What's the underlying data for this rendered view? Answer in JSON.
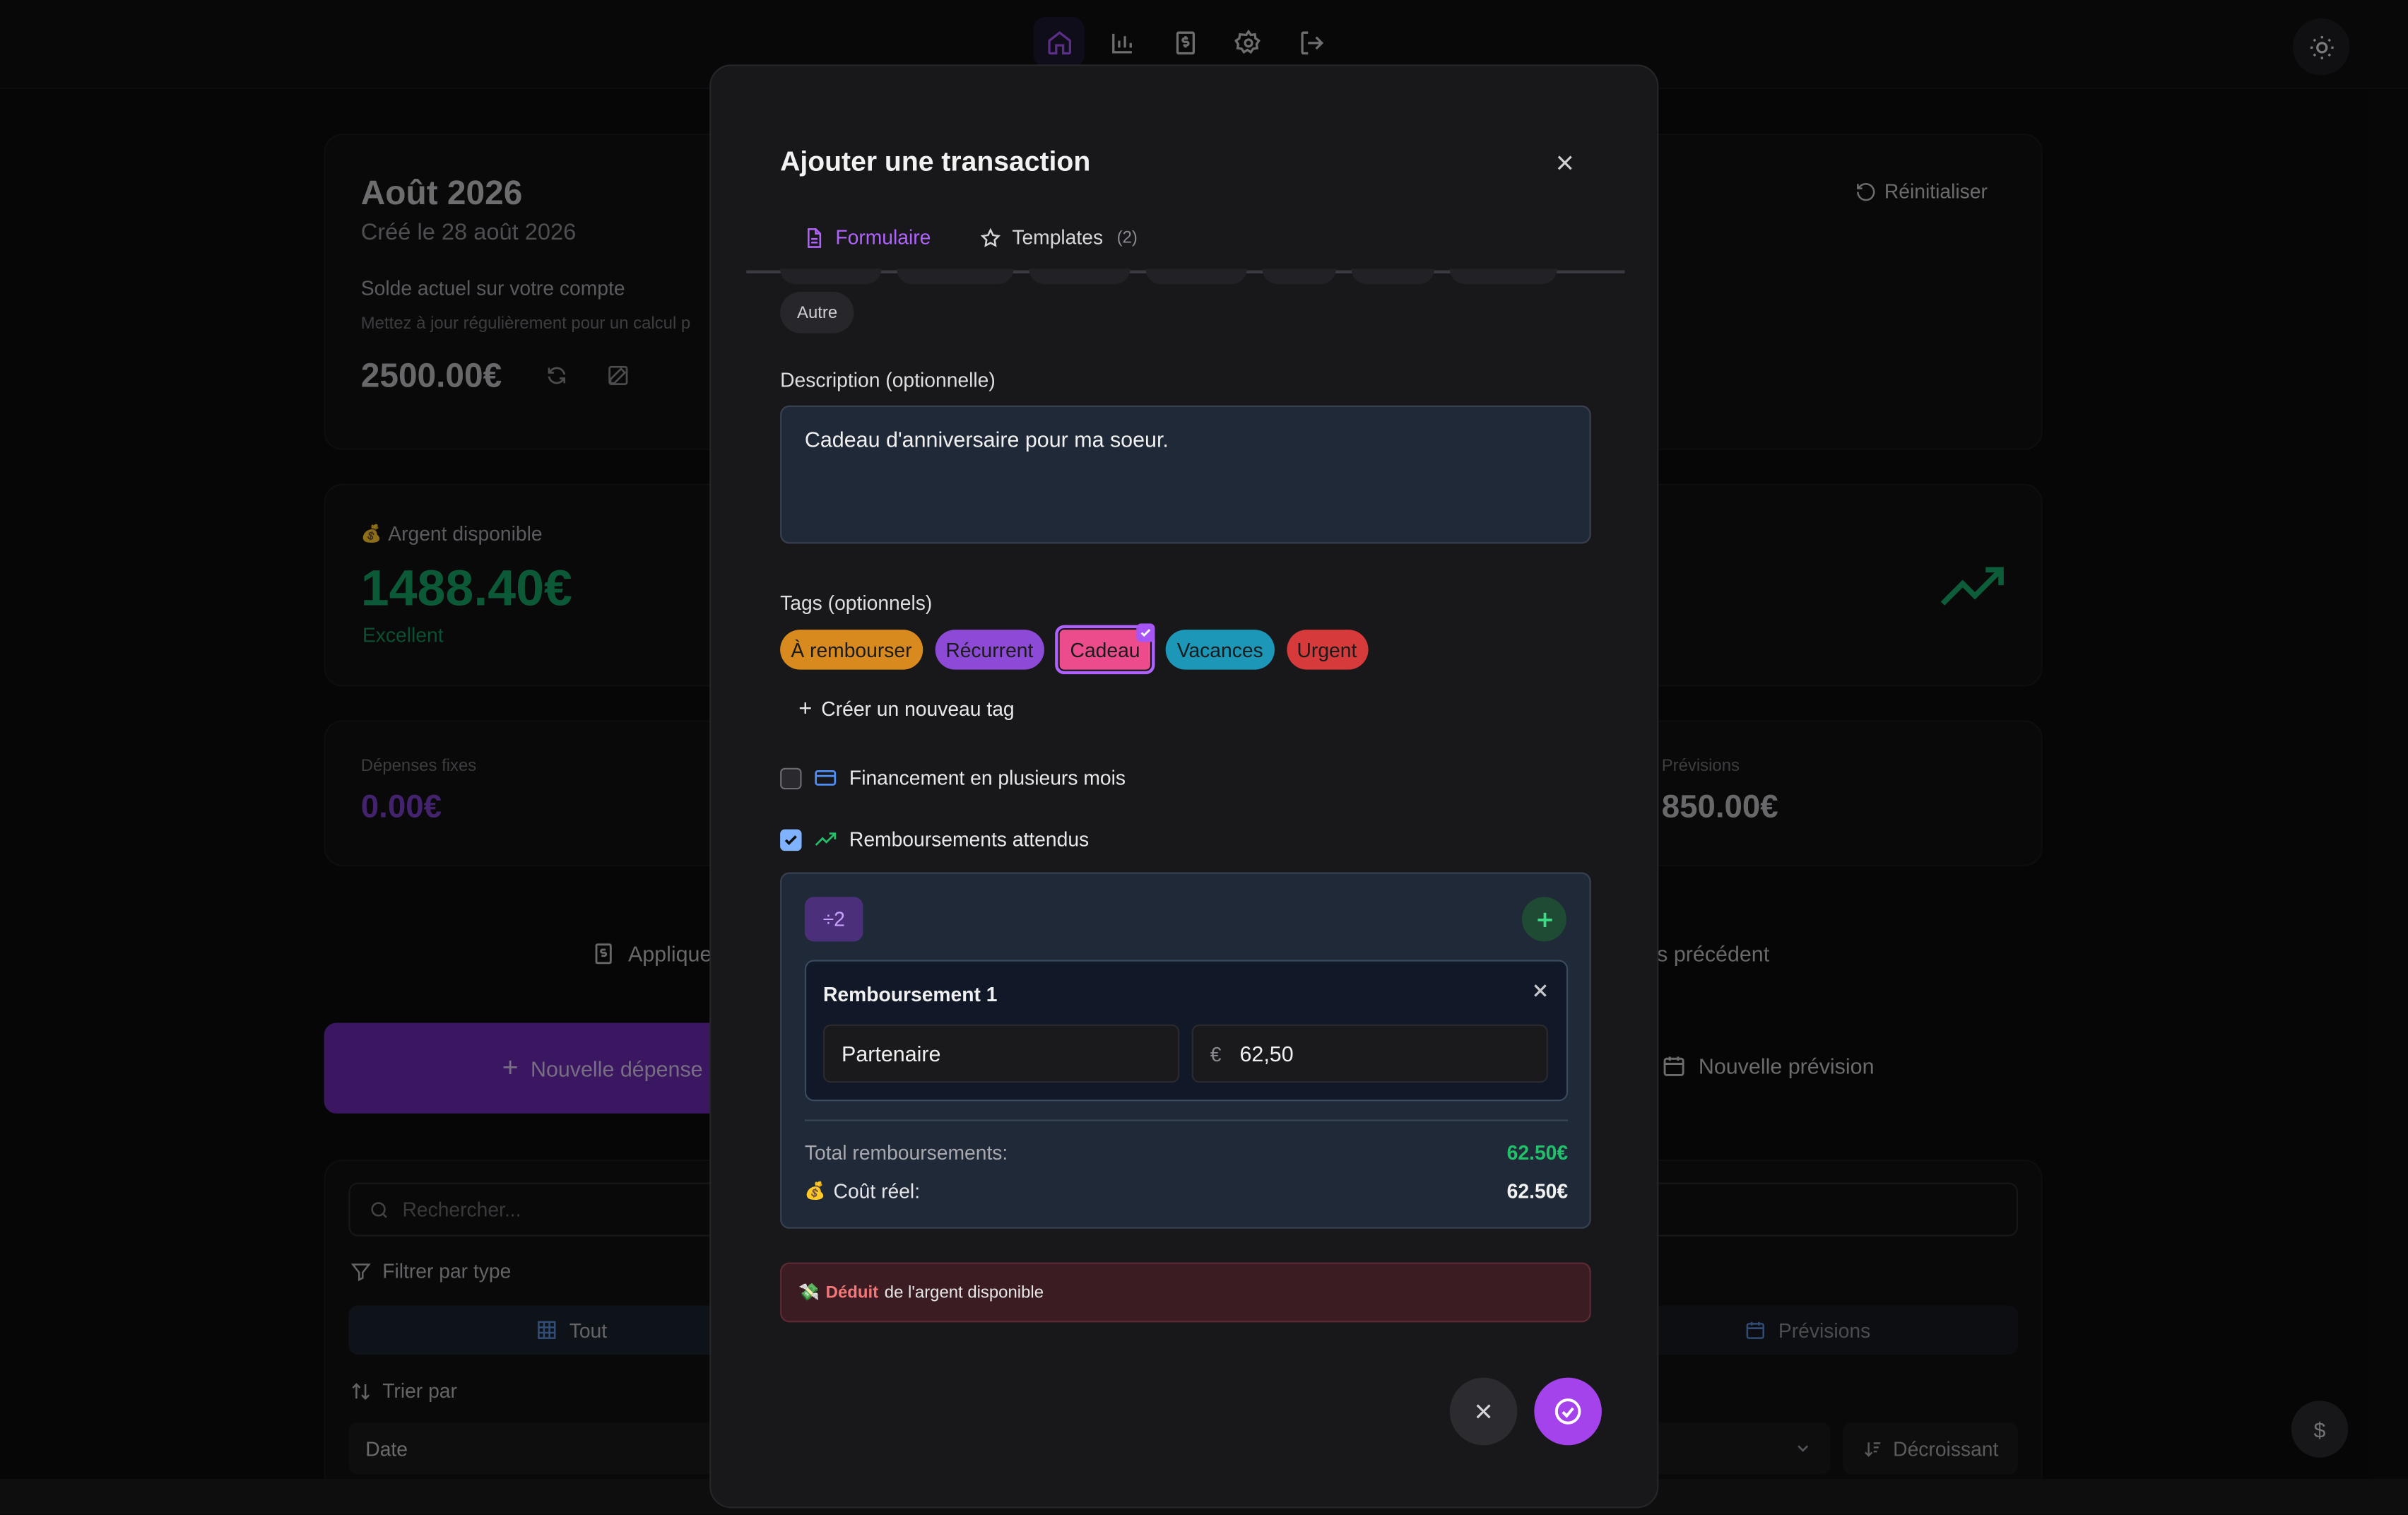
{
  "nav": {
    "icons": [
      "home-icon",
      "bar-chart-icon",
      "dollar-doc-icon",
      "gear-icon",
      "logout-icon"
    ],
    "active": "home-icon"
  },
  "page": {
    "header": {
      "title": "Août 2026",
      "subtitle": "Créé le 28 août 2026",
      "reset_label": "Réinitialiser"
    },
    "balance": {
      "label": "Solde actuel sur votre compte",
      "hint": "Mettez à jour régulièrement pour un calcul p",
      "value": "2500.00€"
    },
    "available": {
      "label": "Argent disponible",
      "value": "1488.40€",
      "status": "Excellent"
    },
    "fixed": {
      "label": "Dépenses fixes",
      "value": "0.00€"
    },
    "forecast": {
      "label": "Prévisions",
      "value": "850.00€"
    },
    "row_actions": {
      "left": "Applique",
      "right": "s précédent"
    },
    "buttons": {
      "new_expense": "Nouvelle dépense",
      "new_forecast": "Nouvelle prévision"
    },
    "filters": {
      "search_placeholder": "Rechercher...",
      "filter_label": "Filtrer par type",
      "all_label": "Tout",
      "forecast_label": "Prévisions",
      "sort_label": "Trier par",
      "sort_value": "Date",
      "order_label": "Décroissant"
    }
  },
  "modal": {
    "title": "Ajouter une transaction",
    "tabs": {
      "form": "Formulaire",
      "templates": "Templates",
      "templates_count": "(2)"
    },
    "category_chip": "Autre",
    "description": {
      "label": "Description (optionnelle)",
      "value": "Cadeau d'anniversaire pour ma soeur."
    },
    "tags": {
      "label": "Tags (optionnels)",
      "items": [
        {
          "label": "À rembourser",
          "color": "#d98a1e"
        },
        {
          "label": "Récurrent",
          "color": "#8d4ad6"
        },
        {
          "label": "Cadeau",
          "color": "#ec4b8c"
        },
        {
          "label": "Vacances",
          "color": "#1c97b8"
        },
        {
          "label": "Urgent",
          "color": "#d63a3a"
        }
      ],
      "create_label": "Créer un nouveau tag"
    },
    "financing_label": "Financement en plusieurs mois",
    "reimbursements": {
      "label": "Remboursements attendus",
      "split_label": "÷2",
      "item_label": "Remboursement 1",
      "person": "Partenaire",
      "currency": "€",
      "amount": "62,50",
      "total_label": "Total remboursements:",
      "total_value": "62.50€",
      "real_cost_label": "Coût réel:",
      "real_cost_value": "62.50€"
    },
    "alert": {
      "highlight": "Déduit",
      "text": "de l'argent disponible"
    }
  },
  "colors": {
    "accent": "#a442ec",
    "positive": "#22c06a",
    "available": "#16a366"
  }
}
